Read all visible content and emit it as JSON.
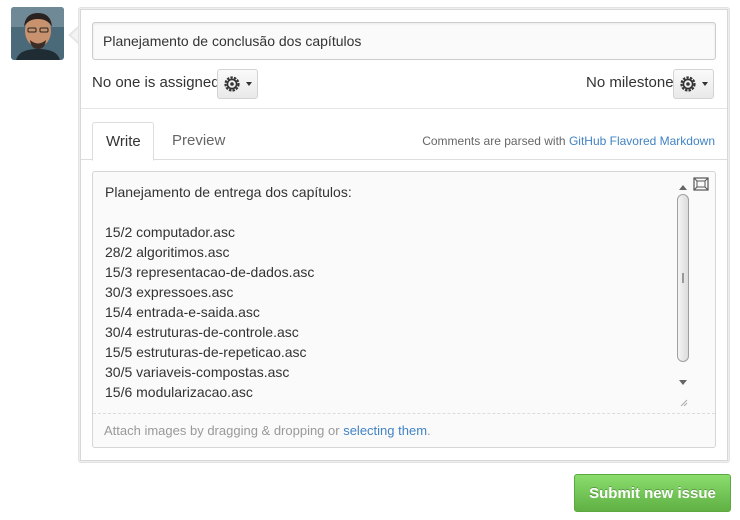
{
  "issue": {
    "title_value": "Planejamento de conclusão dos capítulos"
  },
  "assignee": {
    "text": "No one is assigned",
    "icon": "gear-icon"
  },
  "milestone": {
    "text": "No milestone",
    "icon": "gear-icon"
  },
  "tabs": [
    {
      "label": "Write",
      "active": true
    },
    {
      "label": "Preview",
      "active": false
    }
  ],
  "markdown_note": {
    "prefix": "Comments are parsed with ",
    "link": "GitHub Flavored Markdown"
  },
  "editor": {
    "body": "Planejamento de entrega dos capítulos:\n\n15/2 computador.asc\n28/2 algoritimos.asc\n15/3 representacao-de-dados.asc\n30/3 expressoes.asc\n15/4 entrada-e-saida.asc\n30/4 estruturas-de-controle.asc\n15/5 estruturas-de-repeticao.asc\n30/5 variaveis-compostas.asc\n15/6 modularizacao.asc",
    "fullscreen_icon": "fullscreen-icon"
  },
  "attach": {
    "prefix": "Attach images by dragging & dropping or ",
    "link": "selecting them",
    "suffix": "."
  },
  "submit": {
    "label": "Submit new issue"
  },
  "colors": {
    "accent_link": "#4183c4",
    "submit_green": "#60b044"
  }
}
